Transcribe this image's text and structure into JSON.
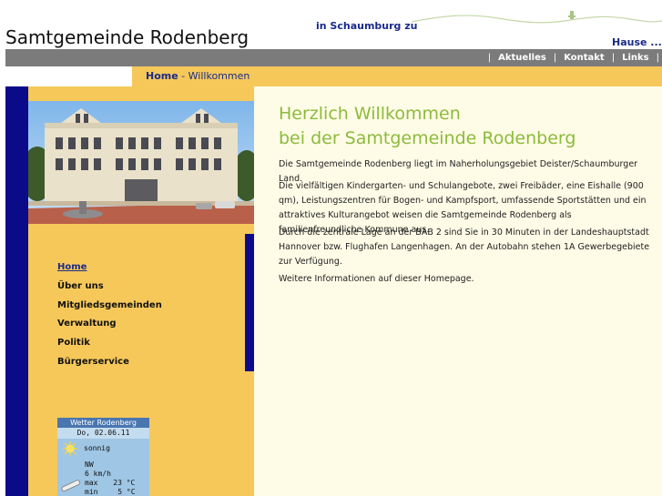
{
  "header": {
    "site_title": "Samtgemeinde Rodenberg",
    "slogan_part1": "in Schaumburg zu",
    "slogan_part2": "Hause ..."
  },
  "topnav": {
    "items": [
      {
        "label": "Aktuelles"
      },
      {
        "label": "Kontakt"
      },
      {
        "label": "Links"
      }
    ]
  },
  "breadcrumb": {
    "home": "Home",
    "separator": " - ",
    "current": "Willkommen"
  },
  "leftnav": {
    "items": [
      {
        "label": "Home",
        "active": true
      },
      {
        "label": "Über uns"
      },
      {
        "label": "Mitgliedsgemeinden"
      },
      {
        "label": "Verwaltung"
      },
      {
        "label": "Politik"
      },
      {
        "label": "Bürgerservice"
      }
    ]
  },
  "weather": {
    "title": "Wetter Rodenberg",
    "date": "Do, 02.06.11",
    "condition": "sonnig",
    "wind_dir": "NW",
    "wind_speed": "6 km/h",
    "max_label": "max",
    "max_value": "23 °C",
    "min_label": "min",
    "min_value": "5 °C"
  },
  "main": {
    "heading_line1": "Herzlich Willkommen",
    "heading_line2": "bei der Samtgemeinde Rodenberg",
    "paragraphs": [
      "Die Samtgemeinde Rodenberg liegt im Naherholungsgebiet Deister/Schaumburger Land.",
      "Die vielfältigen Kindergarten- und Schulangebote, zwei Freibäder, eine Eishalle (900 qm), Leistungszentren für Bogen- und Kampfsport, umfassende Sportstätten und ein attraktives Kulturangebot weisen die Samtgemeinde Rodenberg als familienfreundliche Kommune aus.",
      "Durch die zentrale Lage an der BAB 2 sind Sie in 30 Minuten in der Landeshauptstadt Hannover bzw. Flughafen Langenhagen. An der Autobahn stehen 1A Gewerbegebiete zur Verfügung.",
      "Weitere Informationen auf dieser Homepage."
    ]
  },
  "colors": {
    "navy": "#0b0b8a",
    "gold": "#f6c85a",
    "gray_bar": "#7b7b7b",
    "heading_green": "#8cbb3c",
    "link_blue": "#1a2a8a"
  }
}
